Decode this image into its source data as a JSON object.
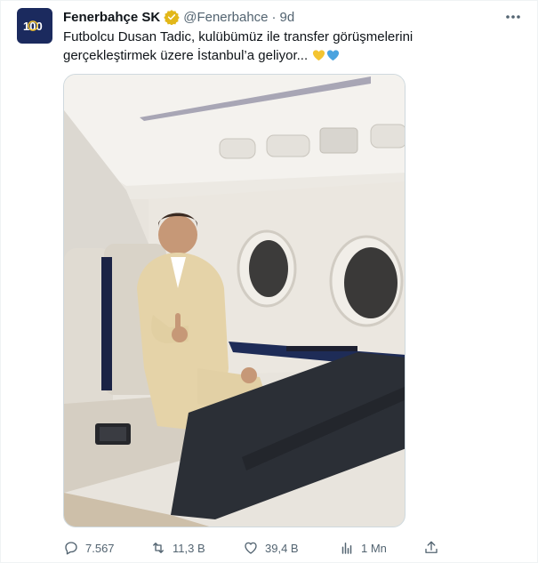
{
  "tweet": {
    "author_name": "Fenerbahçe SK",
    "handle": "@Fenerbahce",
    "separator": "·",
    "time": "9d",
    "text_line1": "Futbolcu Dusan Tadic, kulübümüz ile transfer görüşmelerini",
    "text_line2": "gerçekleştirmek üzere İstanbul’a geliyor...",
    "verified_badge_color": "#E2B719",
    "heart_colors": [
      "#F4C430",
      "#4AA3DF"
    ]
  },
  "avatar": {
    "label": "100",
    "background": "#1B2A5E"
  },
  "media": {
    "description_icon": "photo",
    "image_kind": "player-in-private-jet-cabin"
  },
  "actions": {
    "replies": "7.567",
    "retweets": "11,3 B",
    "likes": "39,4 B",
    "views": "1 Mn",
    "reply_icon": "comment-icon",
    "retweet_icon": "retweet-icon",
    "like_icon": "heart-icon",
    "views_icon": "analytics-icon",
    "share_icon": "share-icon"
  },
  "colors": {
    "text_primary": "#0F1419",
    "text_secondary": "#536471",
    "border": "#CFD9DE"
  }
}
